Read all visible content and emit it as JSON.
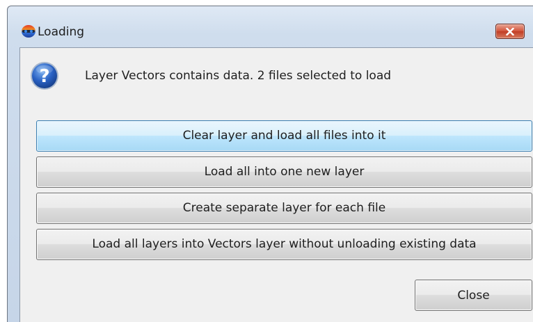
{
  "window": {
    "title": "Loading",
    "app_icon": "rainbow-globe-icon",
    "close_icon": "close-icon"
  },
  "dialog": {
    "icon": "question-icon",
    "message": "Layer Vectors contains data. 2 files selected to load",
    "options": [
      {
        "label": "Clear layer and load all files into it",
        "default": true
      },
      {
        "label": "Load all into one new layer",
        "default": false
      },
      {
        "label": "Create separate layer for each file",
        "default": false
      },
      {
        "label": "Load all layers into Vectors layer without unloading existing data",
        "default": false
      }
    ],
    "close_label": "Close"
  },
  "colors": {
    "titlebar": "#cfdded",
    "client_bg": "#f0f0f0",
    "default_button": "#bee6fd",
    "close_x": "#c13d24"
  }
}
